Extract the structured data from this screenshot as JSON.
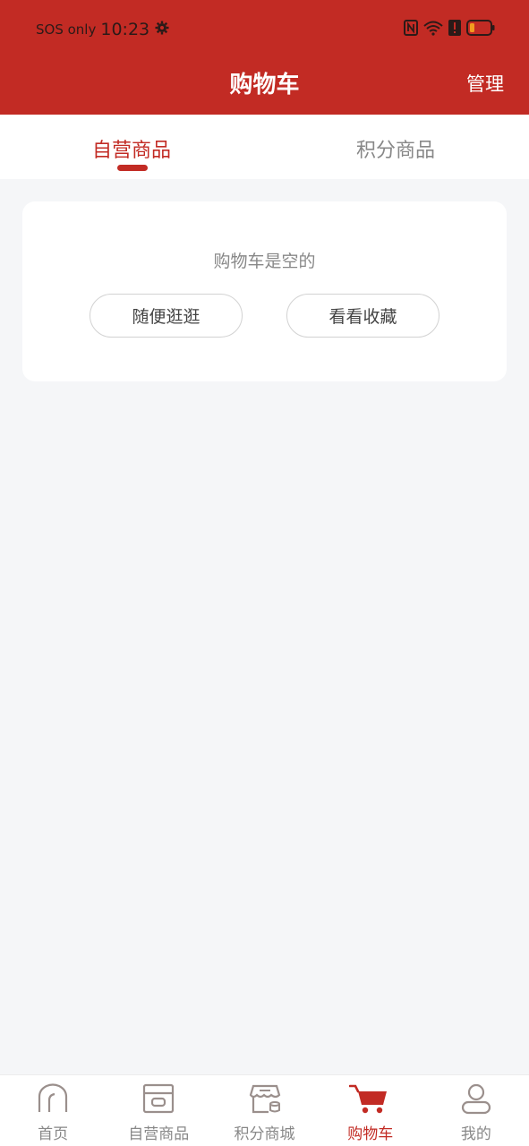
{
  "status_bar": {
    "carrier": "SOS only",
    "time": "10:23",
    "icons": [
      "settings-gear-icon",
      "nfc-icon",
      "wifi-icon",
      "alert-icon",
      "battery-icon"
    ]
  },
  "header": {
    "title": "购物车",
    "manage_label": "管理"
  },
  "tabs": [
    {
      "label": "自营商品",
      "active": true
    },
    {
      "label": "积分商品",
      "active": false
    }
  ],
  "cart": {
    "empty_text": "购物车是空的",
    "browse_label": "随便逛逛",
    "favorites_label": "看看收藏"
  },
  "bottom_nav": [
    {
      "label": "首页",
      "icon": "home-icon",
      "active": false
    },
    {
      "label": "自营商品",
      "icon": "store-box-icon",
      "active": false
    },
    {
      "label": "积分商城",
      "icon": "points-shop-icon",
      "active": false
    },
    {
      "label": "购物车",
      "icon": "cart-icon",
      "active": true
    },
    {
      "label": "我的",
      "icon": "user-icon",
      "active": false
    }
  ],
  "colors": {
    "brand": "#c22b24",
    "background": "#f5f6f8",
    "inactive": "#888888"
  }
}
